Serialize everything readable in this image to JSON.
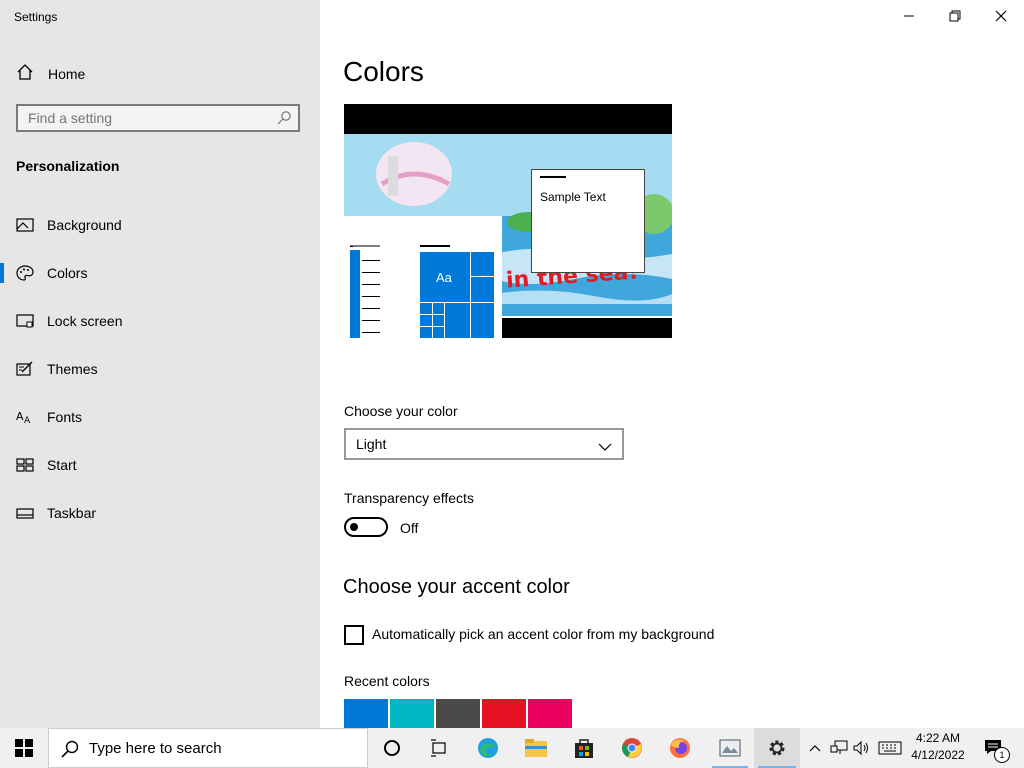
{
  "window": {
    "title": "Settings"
  },
  "sidebar": {
    "home_label": "Home",
    "search_placeholder": "Find a setting",
    "section": "Personalization",
    "items": [
      {
        "label": "Background",
        "icon": "image-icon",
        "active": false
      },
      {
        "label": "Colors",
        "icon": "palette-icon",
        "active": true
      },
      {
        "label": "Lock screen",
        "icon": "lock-screen-icon",
        "active": false
      },
      {
        "label": "Themes",
        "icon": "themes-icon",
        "active": false
      },
      {
        "label": "Fonts",
        "icon": "fonts-icon",
        "active": false
      },
      {
        "label": "Start",
        "icon": "start-icon",
        "active": false
      },
      {
        "label": "Taskbar",
        "icon": "taskbar-icon",
        "active": false
      }
    ]
  },
  "main": {
    "title": "Colors",
    "preview": {
      "sample_text": "Sample Text",
      "tile_label": "Aa",
      "wallpaper_text": "in the sea!"
    },
    "choose_color_label": "Choose your color",
    "choose_color_value": "Light",
    "transparency_label": "Transparency effects",
    "transparency_state": "Off",
    "accent_heading": "Choose your accent color",
    "auto_pick_label": "Automatically pick an accent color from my background",
    "recent_colors_label": "Recent colors",
    "recent_colors": [
      "#0078d7",
      "#00b7c3",
      "#4c4a48",
      "#e81123",
      "#ea005e"
    ],
    "accent_color": "#0078d7"
  },
  "taskbar": {
    "search_placeholder": "Type here to search",
    "time": "4:22 AM",
    "date": "4/12/2022",
    "notification_count": "1",
    "apps": [
      "cortana-icon",
      "task-view-icon",
      "edge-icon",
      "file-explorer-icon",
      "store-icon",
      "chrome-icon",
      "firefox-icon",
      "photos-icon",
      "settings-icon"
    ]
  }
}
